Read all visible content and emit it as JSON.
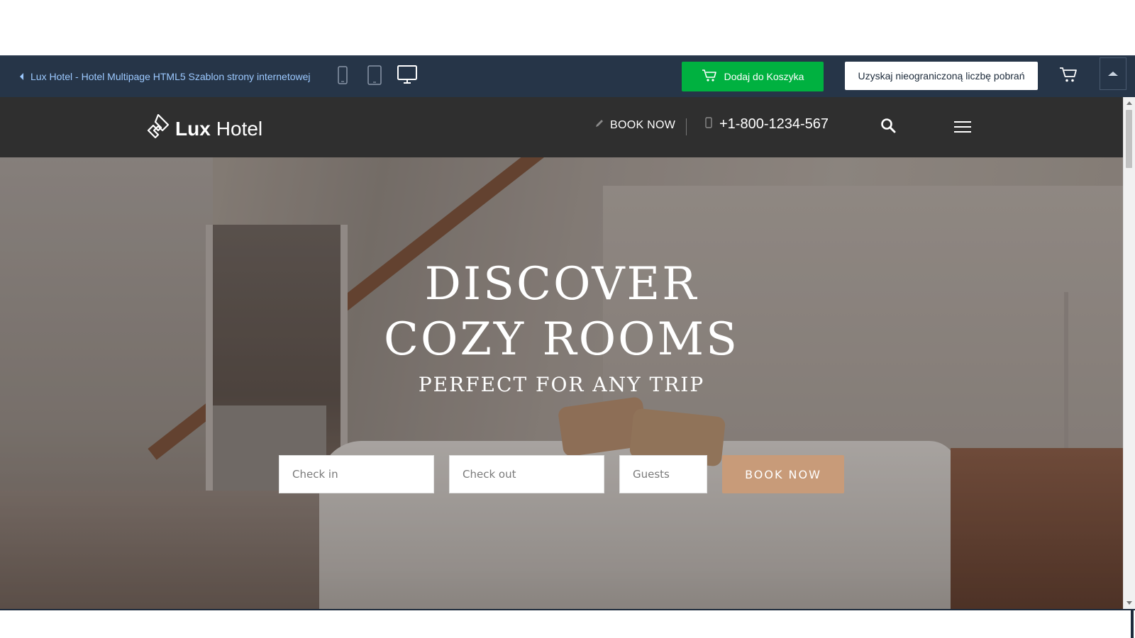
{
  "preview_bar": {
    "back_label": "Lux Hotel - Hotel Multipage HTML5 Szablon strony internetowej",
    "devices": [
      "phone-icon",
      "tablet-icon",
      "desktop-icon"
    ],
    "add_to_cart_label": "Dodaj do Koszyka",
    "unlimited_label": "Uzyskaj nieograniczoną liczbę pobrań",
    "accent_green": "#00b140",
    "background": "#263548"
  },
  "site": {
    "header": {
      "logo_bold": "Lux",
      "logo_light": "Hotel",
      "book_now_label": "BOOK NOW",
      "phone": "+1-800-1234-567",
      "icons": [
        "pencil-icon",
        "mobile-phone-icon",
        "search-icon",
        "hamburger-menu-icon"
      ]
    },
    "hero": {
      "title_line1": "DISCOVER",
      "title_line2": "COZY ROOMS",
      "subtitle": "PERFECT FOR ANY TRIP",
      "form": {
        "checkin_placeholder": "Check in",
        "checkout_placeholder": "Check out",
        "guests_placeholder": "Guests",
        "submit_label": "BOOK NOW",
        "submit_color": "#c89b79"
      }
    }
  }
}
